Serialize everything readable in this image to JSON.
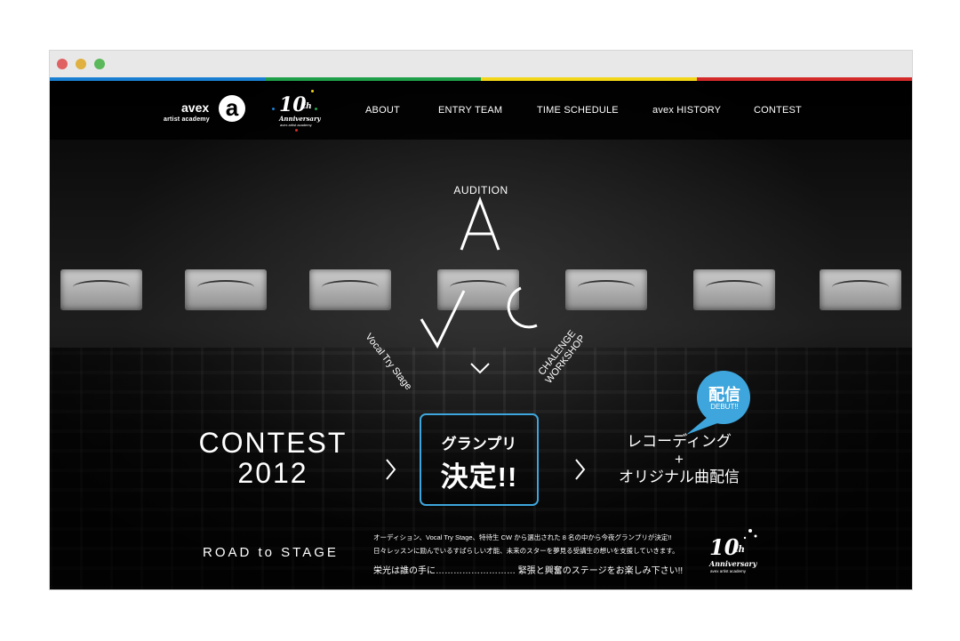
{
  "browser": {
    "dot_colors": [
      "#e06161",
      "#e0b040",
      "#5bb85b"
    ]
  },
  "color_strip": [
    "#1a7fd1",
    "#1f9f49",
    "#f2d617",
    "#d42a2a"
  ],
  "header": {
    "logo_primary": "avex",
    "logo_secondary": "artist academy",
    "logo_mark": "a",
    "anniversary_number": "10",
    "anniversary_suffix": "th",
    "anniversary_word": "Anniversary",
    "anniversary_sub": "avex artist academy",
    "nav": [
      {
        "label": "ABOUT"
      },
      {
        "label": "ENTRY TEAM"
      },
      {
        "label": "TIME SCHEDULE"
      },
      {
        "label": "avex HISTORY"
      },
      {
        "label": "CONTEST"
      }
    ]
  },
  "hero": {
    "audition_label": "AUDITION",
    "letter_top": "A",
    "left_label": "Vocal Try Stage",
    "right_label_line1": "CHALENGE",
    "right_label_line2": "WORKSHOP",
    "scroll_icon": "chevron-down-icon"
  },
  "contest": {
    "title_line1": "CONTEST",
    "title_line2": "2012",
    "arrow": ">",
    "grand_line1": "グランプリ",
    "grand_line2": "決定!!",
    "rec_line1": "レコーディング",
    "rec_line2": "+",
    "rec_line3": "オリジナル曲配信",
    "bubble_main": "配信",
    "bubble_sub": "DEBUT!!",
    "accent_color": "#3ea6dc"
  },
  "footer": {
    "road": "ROAD to STAGE",
    "desc_line1": "オーディション、Vocal Try Stage、特待生 CW から選出された 8 名の中から今夜グランプリが決定!!",
    "desc_line2": "日々レッスンに励んでいるすばらしい才能、未来のスターを夢見る受講生の想いを支援していきます。",
    "desc_strong": "栄光は誰の手に……………………… 緊張と興奮のステージをお楽しみ下さい!!",
    "anniversary_number": "10",
    "anniversary_suffix": "th",
    "anniversary_word": "Anniversary",
    "anniversary_sub": "avex artist academy"
  }
}
